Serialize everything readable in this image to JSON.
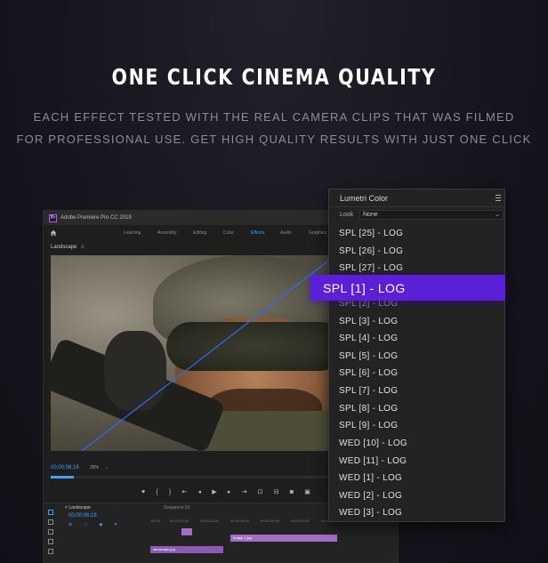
{
  "hero": {
    "headline": "ONE CLICK CINEMA QUALITY",
    "subline_1": "EACH EFFECT TESTED WITH THE REAL CAMERA CLIPS THAT WAS FILMED",
    "subline_2": "FOR PROFESSIONAL USE. GET HIGH QUALITY RESULTS WITH JUST ONE CLICK"
  },
  "premiere": {
    "app_icon": "Pr",
    "title": "Adobe Premiere Pro CC 2019",
    "workspaces": [
      "Learning",
      "Assembly",
      "Editing",
      "Color",
      "Effects",
      "Audio",
      "Graphics"
    ],
    "active_workspace": "Effects",
    "panel_title": "Landscape",
    "timecode": "00;00;06;18",
    "zoom": "25%",
    "playhead_fraction": 0.08,
    "timeline": {
      "tab": "Landscape",
      "time": "00;00;06;18",
      "sequence": "Sequence 01",
      "ruler": [
        ":00;00",
        "00;00;16;00",
        "00;00;32;00",
        "00;00;48;00",
        "00;01;04;02",
        "00;01;20;02",
        "00;0"
      ],
      "clips": [
        "Image 1.jpg",
        "landscape.jpg"
      ]
    }
  },
  "lumetri": {
    "title": "Lumetri Color",
    "look_label": "Look",
    "look_value": "None",
    "items": [
      "SPL [25] - LOG",
      "SPL [26] - LOG",
      "SPL [27] - LOG",
      "SPL [2] - LOG",
      "SPL [3] - LOG",
      "SPL [4] - LOG",
      "SPL [5] - LOG",
      "SPL [6] - LOG",
      "SPL [7] - LOG",
      "SPL [8] - LOG",
      "SPL [9] - LOG",
      "WED [10] - LOG",
      "WED [11] - LOG",
      "WED [1] - LOG",
      "WED [2] - LOG",
      "WED [3] - LOG"
    ],
    "selected_item": "SPL [1] - LOG"
  },
  "colors": {
    "accent_purple": "#5a1fd6",
    "premiere_blue": "#3fa2ff",
    "clip_purple": "#a26ec4"
  }
}
